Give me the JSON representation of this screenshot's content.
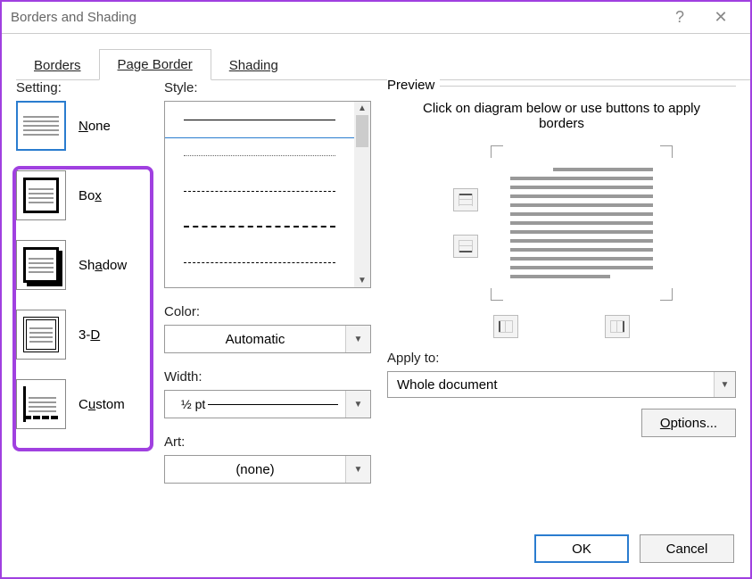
{
  "title": "Borders and Shading",
  "tabs": {
    "borders": "Borders",
    "pageborder": "Page Border",
    "shading": "Shading",
    "active": 1
  },
  "setting": {
    "label": "Setting:",
    "items": [
      {
        "label": "None",
        "underline_idx": 0
      },
      {
        "label": "Box",
        "underline_idx": 2
      },
      {
        "label": "Shadow",
        "underline_idx": 2
      },
      {
        "label": "3-D",
        "underline_idx": 2
      },
      {
        "label": "Custom",
        "underline_idx": 1
      }
    ]
  },
  "style_label": "Style:",
  "color": {
    "label": "Color:",
    "value": "Automatic"
  },
  "width": {
    "label": "Width:",
    "value": "½ pt"
  },
  "art": {
    "label": "Art:",
    "value": "(none)"
  },
  "preview": {
    "legend": "Preview",
    "hint": "Click on diagram below or use buttons to apply borders"
  },
  "apply": {
    "label": "Apply to:",
    "value": "Whole document"
  },
  "options_btn": "Options...",
  "ok_btn": "OK",
  "cancel_btn": "Cancel"
}
